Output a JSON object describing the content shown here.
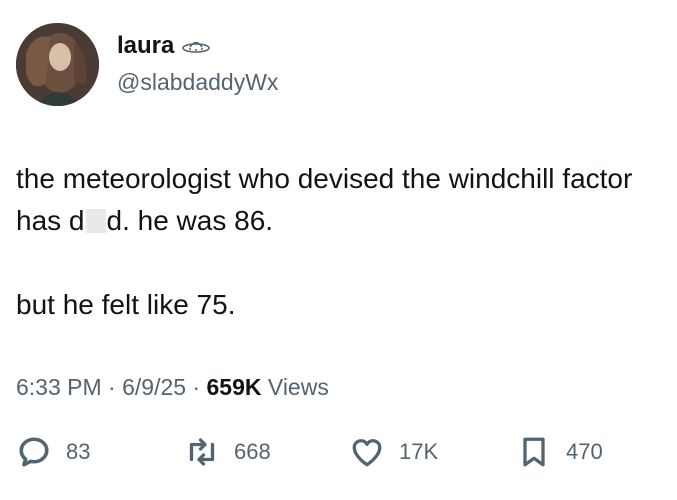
{
  "author": {
    "display_name": "laura",
    "handle": "@slabdaddyWx",
    "badge_icon": "ufo-icon"
  },
  "tweet": {
    "text_line1_before": "the meteorologist who devised the windchill factor has d",
    "text_line1_after": "d. he was 86.",
    "text_line2": "but he felt like 75."
  },
  "meta": {
    "time": "6:33 PM",
    "date": "6/9/25",
    "views_count": "659K",
    "views_label": "Views",
    "separator": "·"
  },
  "actions": {
    "replies": "83",
    "reposts": "668",
    "likes": "17K",
    "bookmarks": "470"
  },
  "colors": {
    "text": "#0f1419",
    "secondary": "#536471",
    "background": "#ffffff"
  }
}
